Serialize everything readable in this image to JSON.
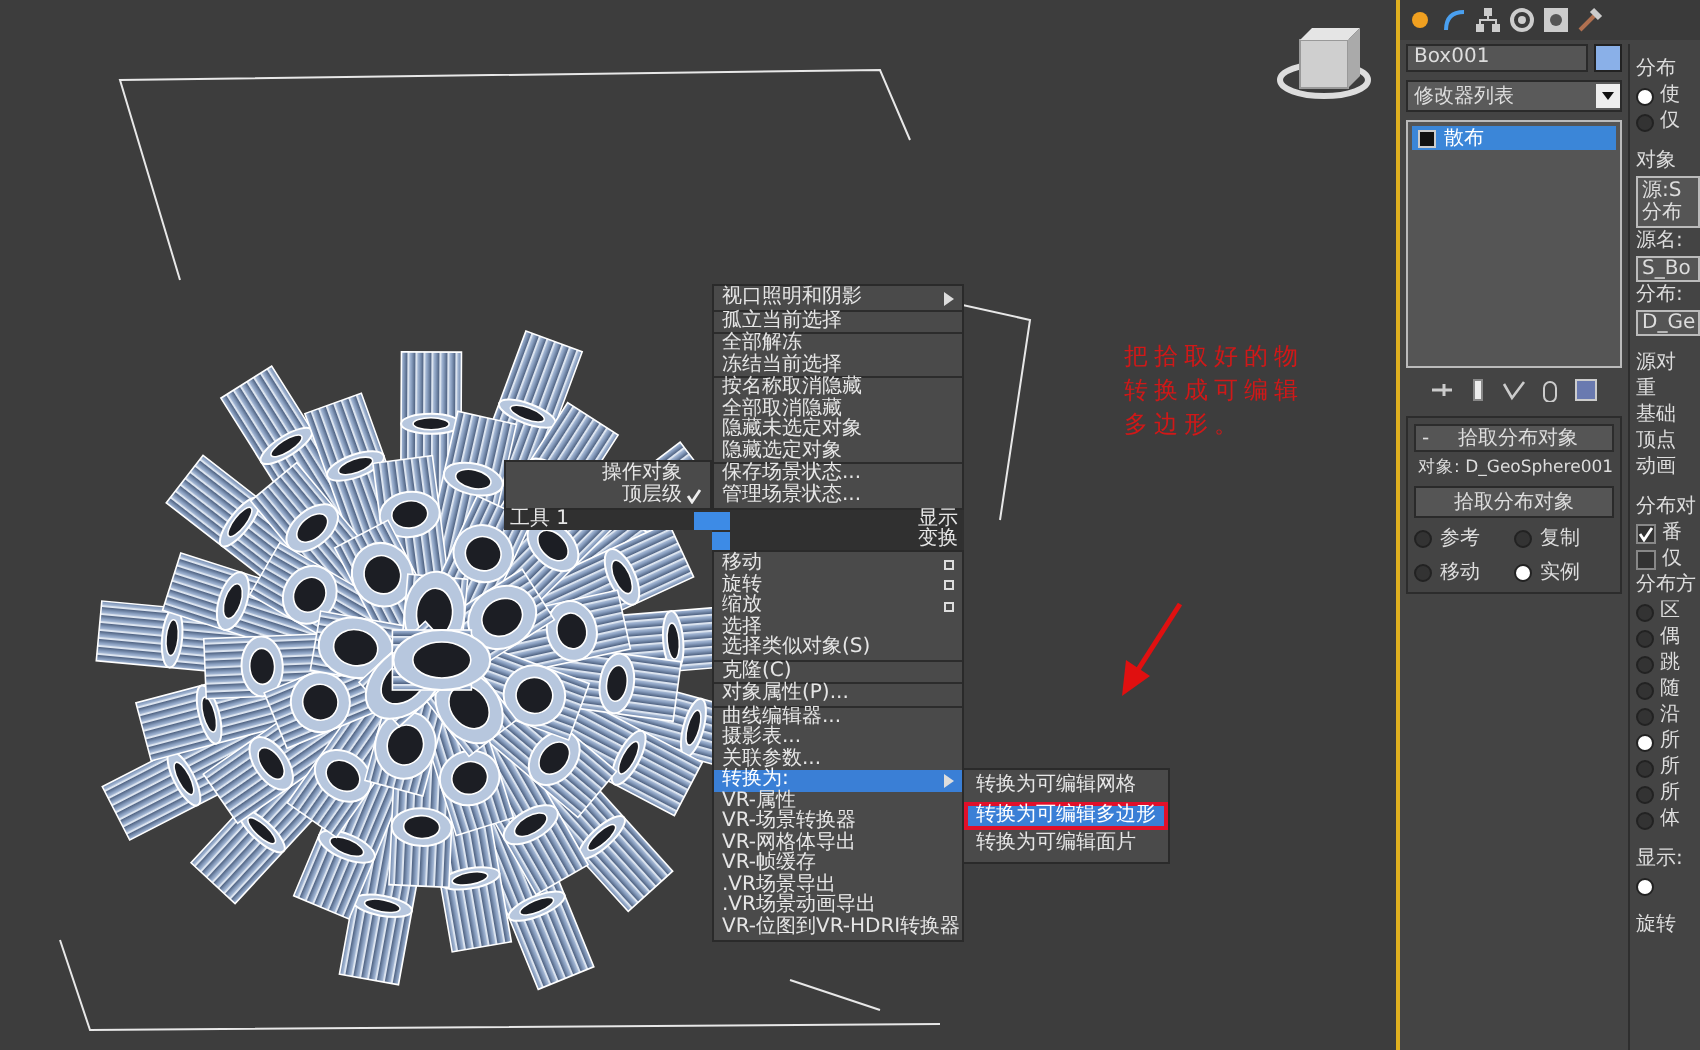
{
  "viewport": {
    "annotation": {
      "lines": [
        "把拾取好的物",
        "转换成可编辑",
        "多边形。"
      ]
    }
  },
  "quad_menu": {
    "left_items": [
      {
        "label": "操作对象",
        "checked": false
      },
      {
        "label": "顶层级",
        "checked": true
      }
    ],
    "tools_label": "工具 1",
    "display_label": "显示",
    "transform_label": "变换",
    "upper_groups": [
      [
        {
          "label": "视口照明和阴影",
          "kind": "submenu",
          "selected": false
        }
      ],
      [
        {
          "label": "孤立当前选择",
          "kind": "plain",
          "selected": false
        }
      ],
      [
        {
          "label": "全部解冻",
          "kind": "plain",
          "selected": false
        },
        {
          "label": "冻结当前选择",
          "kind": "plain",
          "selected": false
        }
      ],
      [
        {
          "label": "按名称取消隐藏",
          "kind": "plain",
          "selected": false
        },
        {
          "label": "全部取消隐藏",
          "kind": "plain",
          "selected": false
        },
        {
          "label": "隐藏未选定对象",
          "kind": "plain",
          "selected": false
        },
        {
          "label": "隐藏选定对象",
          "kind": "plain",
          "selected": false
        }
      ],
      [
        {
          "label": "保存场景状态...",
          "kind": "plain",
          "selected": false
        },
        {
          "label": "管理场景状态...",
          "kind": "plain",
          "selected": false
        }
      ]
    ],
    "lower_groups": [
      [
        {
          "label": "移动",
          "kind": "option",
          "selected": false
        },
        {
          "label": "旋转",
          "kind": "option",
          "selected": false
        },
        {
          "label": "缩放",
          "kind": "option",
          "selected": false
        },
        {
          "label": "选择",
          "kind": "plain",
          "selected": false
        },
        {
          "label": "选择类似对象(S)",
          "kind": "plain",
          "selected": false
        }
      ],
      [
        {
          "label": "克隆(C)",
          "kind": "plain",
          "selected": false
        }
      ],
      [
        {
          "label": "对象属性(P)...",
          "kind": "plain",
          "selected": false
        }
      ],
      [
        {
          "label": "曲线编辑器...",
          "kind": "plain",
          "selected": false
        },
        {
          "label": "摄影表...",
          "kind": "plain",
          "selected": false
        },
        {
          "label": "关联参数...",
          "kind": "plain",
          "selected": false
        },
        {
          "label": "转换为:",
          "kind": "submenu",
          "selected": true,
          "submenu": [
            {
              "label": "转换为可编辑网格",
              "selected": false,
              "annotated": false
            },
            {
              "label": "转换为可编辑多边形",
              "selected": true,
              "annotated": true
            },
            {
              "label": "转换为可编辑面片",
              "selected": false,
              "annotated": false
            }
          ]
        },
        {
          "label": "VR-属性",
          "kind": "plain",
          "selected": false
        },
        {
          "label": "VR-场景转换器",
          "kind": "plain",
          "selected": false
        },
        {
          "label": "VR-网格体导出",
          "kind": "plain",
          "selected": false
        },
        {
          "label": "VR-帧缓存",
          "kind": "plain",
          "selected": false
        },
        {
          "label": ".VR场景导出",
          "kind": "plain",
          "selected": false
        },
        {
          "label": ".VR场景动画导出",
          "kind": "plain",
          "selected": false
        },
        {
          "label": "VR-位图到VR-HDRI转换器",
          "kind": "plain",
          "selected": false
        }
      ]
    ]
  },
  "command_panel": {
    "name_field": {
      "value": "Box001"
    },
    "modifier_list": {
      "label": "修改器列表"
    },
    "stack": [
      {
        "label": "散布",
        "selected": true
      }
    ],
    "rollout": {
      "collapse": "-",
      "title": "拾取分布对象",
      "object_label": "对象: D_GeoSphere001",
      "button": "拾取分布对象",
      "radios": [
        {
          "label": "参考",
          "selected": false
        },
        {
          "label": "复制",
          "selected": false
        },
        {
          "label": "移动",
          "selected": false
        },
        {
          "label": "实例",
          "selected": true
        }
      ]
    },
    "column_2": [
      {
        "kind": "group",
        "label": "分布"
      },
      {
        "kind": "radio",
        "label": "使",
        "selected": true
      },
      {
        "kind": "radio",
        "label": "仅",
        "selected": false
      },
      {
        "kind": "group",
        "label": "对象"
      },
      {
        "kind": "box",
        "lines": [
          "源:S",
          "分布"
        ]
      },
      {
        "kind": "text",
        "label": "源名:"
      },
      {
        "kind": "field",
        "value": "S_Bo"
      },
      {
        "kind": "text",
        "label": "分布:"
      },
      {
        "kind": "field",
        "value": "D_Ge"
      },
      {
        "kind": "group",
        "label": "源对"
      },
      {
        "kind": "text",
        "label": "重"
      },
      {
        "kind": "text",
        "label": "基础"
      },
      {
        "kind": "text",
        "label": "顶点"
      },
      {
        "kind": "text",
        "label": "动画"
      },
      {
        "kind": "group",
        "label": "分布对"
      },
      {
        "kind": "checkbox",
        "label": "番",
        "checked": true
      },
      {
        "kind": "checkbox",
        "label": "仅",
        "checked": false
      },
      {
        "kind": "text",
        "label": "分布方"
      },
      {
        "kind": "radio",
        "label": "区",
        "selected": false
      },
      {
        "kind": "radio",
        "label": "偶",
        "selected": false
      },
      {
        "kind": "radio",
        "label": "跳",
        "selected": false
      },
      {
        "kind": "radio",
        "label": "随",
        "selected": false
      },
      {
        "kind": "radio",
        "label": "沿",
        "selected": false
      },
      {
        "kind": "radio",
        "label": "所",
        "selected": true
      },
      {
        "kind": "radio",
        "label": "所",
        "selected": false
      },
      {
        "kind": "radio",
        "label": "所",
        "selected": false
      },
      {
        "kind": "radio",
        "label": "体",
        "selected": false
      },
      {
        "kind": "group",
        "label": "显示:"
      },
      {
        "kind": "radio",
        "selected": true
      },
      {
        "kind": "group",
        "label": "旋转"
      }
    ]
  }
}
